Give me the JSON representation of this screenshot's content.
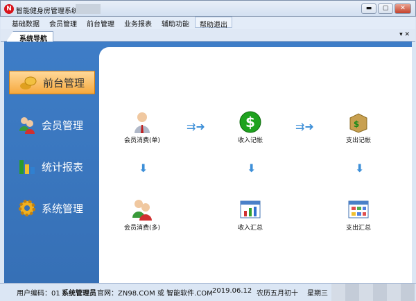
{
  "window": {
    "title": "智能健身房管理系统",
    "minimize": "▬",
    "maximize": "▢",
    "close": "✕"
  },
  "menu": [
    "基础数据",
    "会员管理",
    "前台管理",
    "业务报表",
    "辅助功能",
    "帮助退出"
  ],
  "tab": {
    "label": "系统导航",
    "controls": "▾ ✕"
  },
  "nav": [
    {
      "label": "前台管理"
    },
    {
      "label": "会员管理"
    },
    {
      "label": "统计报表"
    },
    {
      "label": "系统管理"
    }
  ],
  "nodes": {
    "member_single": "会员消费(单)",
    "income_record": "收入记帐",
    "expense_record": "支出记帐",
    "member_multi": "会员消费(多)",
    "income_summary": "收入汇总",
    "expense_summary": "支出汇总"
  },
  "status": {
    "user_code": "用户编码：01",
    "operator": "系统管理员",
    "website": "官网：ZN98.COM 或 智能软件.COM",
    "date": "2019.06.12",
    "lunar": "农历五月初十",
    "weekday": "星期三"
  },
  "colors": {
    "accent": "#3e7dc7",
    "active_nav": "#f6a93e"
  }
}
